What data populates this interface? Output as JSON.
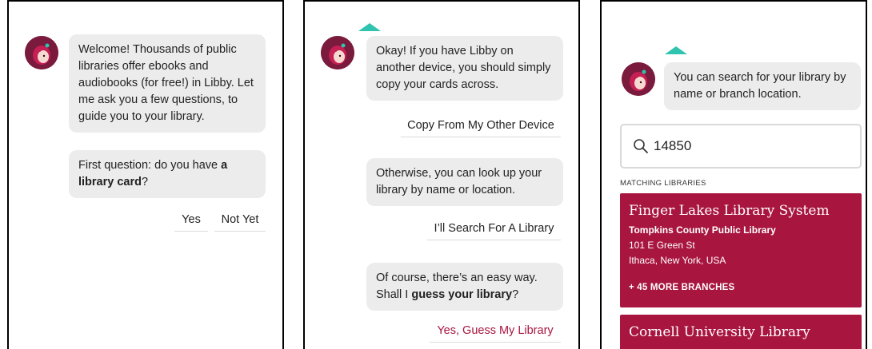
{
  "colors": {
    "accent": "#a8153f",
    "teal": "#2fc3b0",
    "bubble": "#ececec"
  },
  "panel1": {
    "welcome": "Welcome! Thousands of public libraries offer ebooks and audiobooks (for free!) in Libby. Let me ask you a few questions, to guide you to your library.",
    "question_prefix": "First question: do you have ",
    "question_bold": "a library card",
    "question_suffix": "?",
    "yes_label": "Yes",
    "not_yet_label": "Not Yet"
  },
  "panel2": {
    "copy_msg": "Okay! If you have Libby on another device, you should simply copy your cards across.",
    "copy_button": "Copy From My Other Device",
    "search_msg": "Otherwise, you can look up your library by name or location.",
    "search_button": "I’ll Search For A Library",
    "guess_msg_prefix": "Of course, there’s an easy way. Shall I ",
    "guess_msg_bold": "guess your library",
    "guess_msg_suffix": "?",
    "guess_button": "Yes, Guess My Library"
  },
  "panel3": {
    "prompt": "You can search for your library by name or branch location.",
    "search_value": "14850",
    "section_label": "MATCHING LIBRARIES",
    "results": [
      {
        "name": "Finger Lakes Library System",
        "branch": "Tompkins County Public Library",
        "address1": "101 E Green St",
        "address2": "Ithaca, New York, USA",
        "more": "+ 45 MORE BRANCHES"
      },
      {
        "name": "Cornell University Library"
      }
    ]
  }
}
